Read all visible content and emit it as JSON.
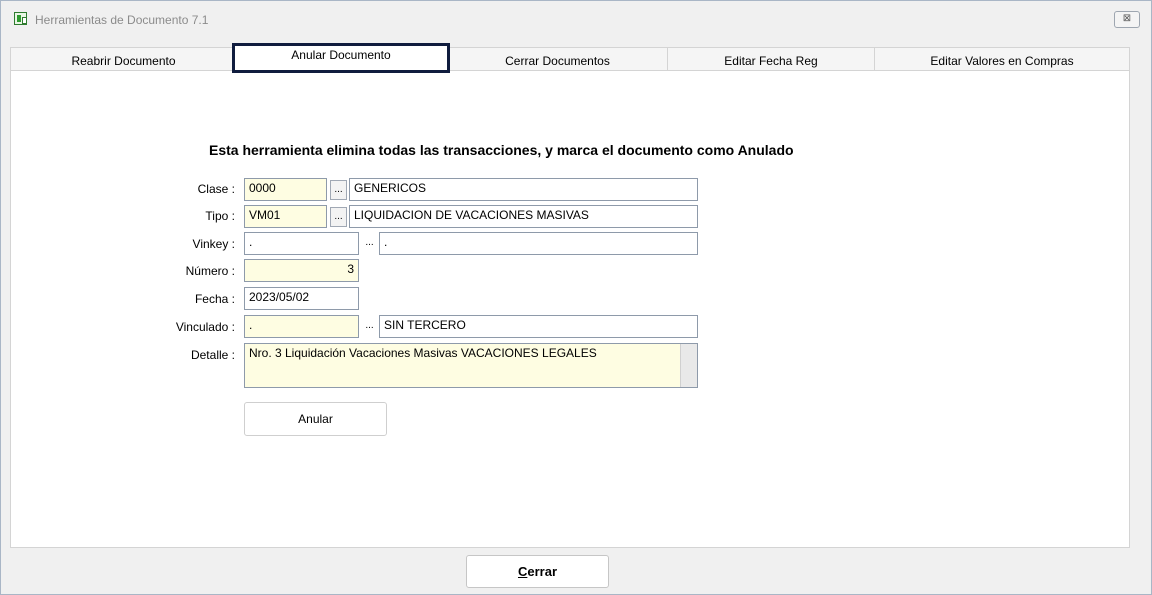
{
  "window": {
    "title": "Herramientas de Documento 7.1",
    "close_symbol": "⊠"
  },
  "tabs": [
    {
      "label": "Reabrir Documento",
      "active": false
    },
    {
      "label": "Anular Documento",
      "active": true
    },
    {
      "label": "Cerrar Documentos",
      "active": false
    },
    {
      "label": "Editar Fecha Reg",
      "active": false
    },
    {
      "label": "Editar Valores en Compras",
      "active": false
    }
  ],
  "form": {
    "heading": "Esta herramienta elimina todas las transacciones, y marca el documento como Anulado",
    "dots_label": "...",
    "clase": {
      "label": "Clase :",
      "code": "0000",
      "description": "GENERICOS"
    },
    "tipo": {
      "label": "Tipo :",
      "code": "VM01",
      "description": "LIQUIDACION DE VACACIONES MASIVAS"
    },
    "vinkey": {
      "label": "Vinkey :",
      "code": ".",
      "description": "."
    },
    "numero": {
      "label": "Número :",
      "value": "3"
    },
    "fecha": {
      "label": "Fecha :",
      "value": "2023/05/02"
    },
    "vinculado": {
      "label": "Vinculado :",
      "code": ".",
      "description": "SIN TERCERO"
    },
    "detalle": {
      "label": "Detalle :",
      "value": "Nro. 3 Liquidación Vacaciones Masivas VACACIONES LEGALES"
    },
    "anular_label": "Anular"
  },
  "footer": {
    "cerrar_first_letter": "C",
    "cerrar_rest": "errar"
  },
  "colors": {
    "active_tab_border": "#101c3e",
    "required_field_bg": "#fefde2",
    "window_bg": "#f0f0f0"
  }
}
